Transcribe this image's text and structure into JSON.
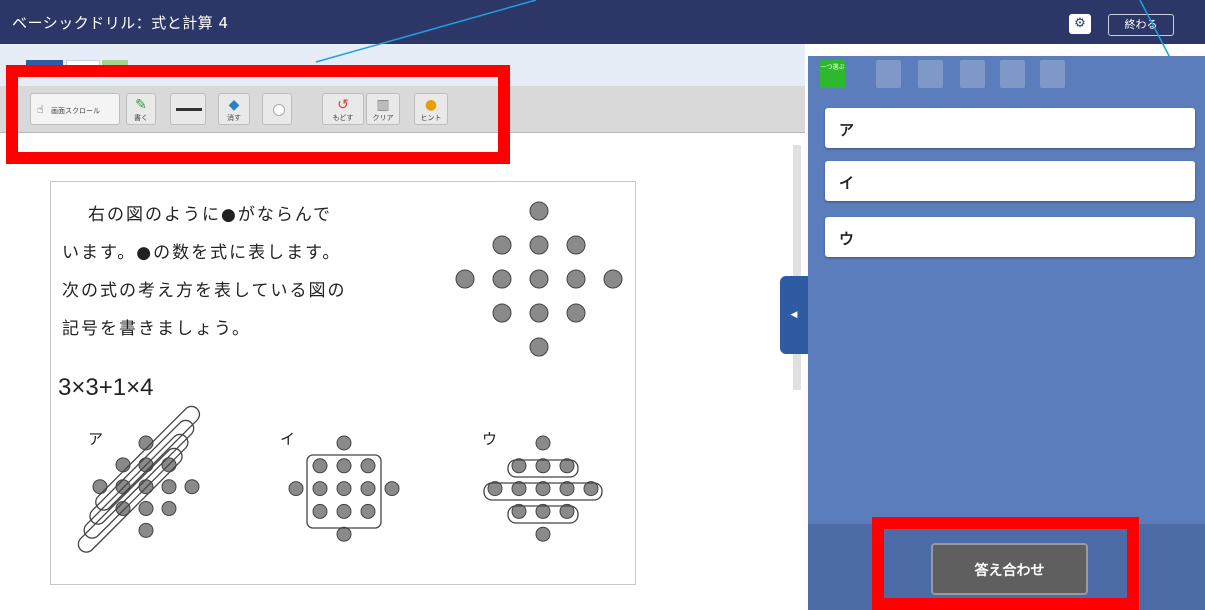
{
  "window": {
    "title": "ベーシックドリル：式と計算 4",
    "end_label": "終わる",
    "icons": [
      "gear-icon"
    ]
  },
  "toolbar": {
    "scroll_label": "画面スクロール",
    "write_label": "書く",
    "erase_label": "消す",
    "undo_label": "もどす",
    "clear_label": "クリア",
    "hint_label": "ヒント"
  },
  "problem": {
    "lines": [
      "右の図のように●がならんで",
      "います。●の数を式に表します。",
      "次の式の考え方を表している図の",
      "記号を書きましょう。"
    ],
    "formula": "3×3+1×4",
    "option_labels": [
      "ア",
      "イ",
      "ウ"
    ]
  },
  "answers": {
    "items": [
      {
        "label": "ア"
      },
      {
        "label": "イ"
      },
      {
        "label": "ウ"
      }
    ]
  },
  "panel_tabs": {
    "active_label": "一つ選ぶ"
  },
  "footer": {
    "check_label": "答え合わせ"
  },
  "colors": {
    "titlebar": "#2c3768",
    "panel": "#5b7dbb",
    "highlight": "#ff0000",
    "accent_green": "#2eb82e"
  }
}
